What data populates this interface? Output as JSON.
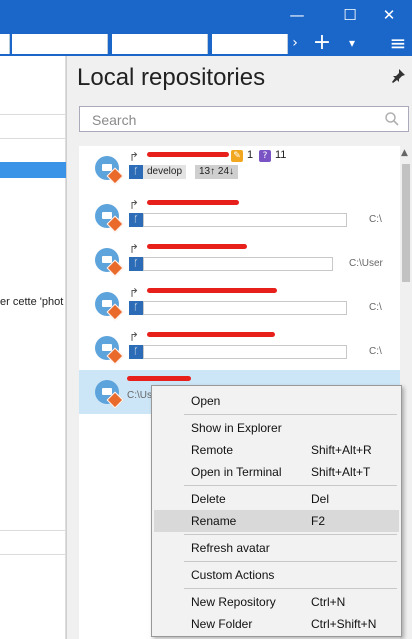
{
  "window": {
    "minimize_glyph": "—",
    "maximize_glyph": "☐",
    "close_glyph": "✕"
  },
  "toolbar": {
    "next_glyph": "›",
    "add_glyph": "+",
    "dropdown_glyph": "▾",
    "menu_glyph": "≡"
  },
  "left_pane": {
    "partial_text": "er cette 'phot"
  },
  "panel": {
    "title": "Local repositories",
    "search_placeholder": "Search"
  },
  "repositories": [
    {
      "branch": "develop",
      "ahead_behind": "13↑ 24↓",
      "changes_count": "1",
      "conflicts_count": "11",
      "path": ""
    },
    {
      "path": "C:\\"
    },
    {
      "path": "C:\\User"
    },
    {
      "path": "C:\\"
    },
    {
      "path": "C:\\"
    },
    {
      "path": "C:\\Us"
    }
  ],
  "context_menu": {
    "items": [
      {
        "label": "Open",
        "shortcut": ""
      },
      {
        "label": "Show in Explorer",
        "shortcut": ""
      },
      {
        "label": "Remote",
        "shortcut": "Shift+Alt+R"
      },
      {
        "label": "Open in Terminal",
        "shortcut": "Shift+Alt+T"
      },
      {
        "label": "Delete",
        "shortcut": "Del"
      },
      {
        "label": "Rename",
        "shortcut": "F2"
      },
      {
        "label": "Refresh avatar",
        "shortcut": ""
      },
      {
        "label": "Custom Actions",
        "shortcut": ""
      },
      {
        "label": "New Repository",
        "shortcut": "Ctrl+N"
      },
      {
        "label": "New Folder",
        "shortcut": "Ctrl+Shift+N"
      }
    ]
  },
  "colors": {
    "accent": "#1b66c9",
    "selection": "#cde6f7",
    "git_badge": "#e96a2b",
    "redaction": "#e8201c"
  }
}
